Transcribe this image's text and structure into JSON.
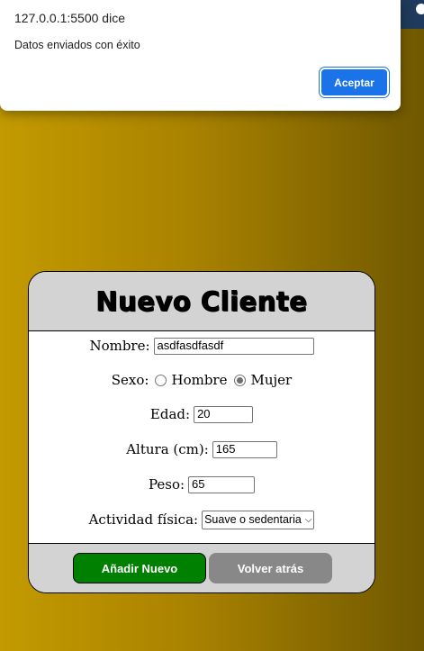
{
  "alert": {
    "title": "127.0.0.1:5500 dice",
    "message": "Datos enviados con éxito",
    "ok_label": "Aceptar"
  },
  "form": {
    "title": "Nuevo Cliente",
    "nombre_label": "Nombre:",
    "nombre_value": "asdfasdfasdf",
    "sexo_label": "Sexo:",
    "sexo_options": [
      "Hombre",
      "Mujer"
    ],
    "sexo_selected": "Mujer",
    "edad_label": "Edad:",
    "edad_value": "20",
    "altura_label": "Altura (cm):",
    "altura_value": "165",
    "peso_label": "Peso:",
    "peso_value": "65",
    "actividad_label": "Actividad física:",
    "actividad_selected": "Suave o sedentaria",
    "add_button": "Añadir Nuevo",
    "back_button": "Volver atrás"
  },
  "colors": {
    "background_gradient_start": "#c39a00",
    "background_gradient_end": "#705800",
    "header_bg": "#d3d3d3",
    "add_button_bg": "#008000",
    "back_button_bg": "#888888",
    "alert_button_bg": "#1a73e8"
  }
}
